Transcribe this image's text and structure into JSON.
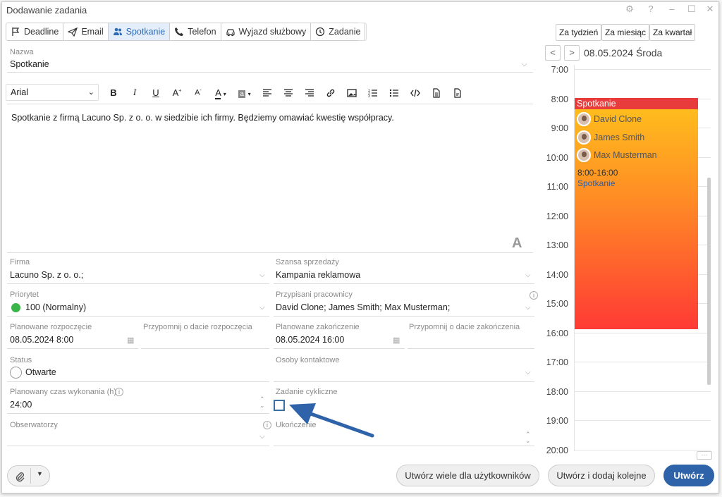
{
  "window": {
    "title": "Dodawanie zadania"
  },
  "tabs": [
    {
      "label": "Deadline",
      "icon": "flag-icon"
    },
    {
      "label": "Email",
      "icon": "paper-plane-icon"
    },
    {
      "label": "Spotkanie",
      "icon": "people-icon",
      "active": true
    },
    {
      "label": "Telefon",
      "icon": "phone-icon"
    },
    {
      "label": "Wyjazd służbowy",
      "icon": "car-icon"
    },
    {
      "label": "Zadanie",
      "icon": "clock-icon"
    }
  ],
  "name_field": {
    "label": "Nazwa",
    "value": "Spotkanie"
  },
  "editor": {
    "font": "Arial",
    "text": "Spotkanie z firmą Lacuno Sp. z o. o. w siedzibie ich firmy. Będziemy omawiać kwestię współpracy.",
    "a_letter": "A"
  },
  "fields": {
    "firma": {
      "label": "Firma",
      "value": "Lacuno Sp. z o. o.;"
    },
    "szansa": {
      "label": "Szansa sprzedaży",
      "value": "Kampania reklamowa"
    },
    "priorytet": {
      "label": "Priorytet",
      "value": "100 (Normalny)"
    },
    "pracownicy": {
      "label": "Przypisani pracownicy",
      "value": "David Clone; James Smith; Max Musterman;"
    },
    "start": {
      "label": "Planowane rozpoczęcie",
      "value": "08.05.2024 8:00"
    },
    "remind_start": {
      "label": "Przypomnij o dacie rozpoczęcia",
      "value": ""
    },
    "end": {
      "label": "Planowane zakończenie",
      "value": "08.05.2024 16:00"
    },
    "remind_end": {
      "label": "Przypomnij o dacie zakończenia",
      "value": ""
    },
    "status": {
      "label": "Status",
      "value": "Otwarte"
    },
    "kontakty": {
      "label": "Osoby kontaktowe",
      "value": ""
    },
    "czas": {
      "label": "Planowany czas wykonania (h)",
      "value": "24:00"
    },
    "cykliczne": {
      "label": "Zadanie cykliczne",
      "checked": false
    },
    "obserwatorzy": {
      "label": "Obserwatorzy",
      "value": ""
    },
    "ukonczenie": {
      "label": "Ukończenie",
      "value": ""
    }
  },
  "calendar": {
    "range_buttons": [
      "Za tydzień",
      "Za miesiąc",
      "Za kwartał"
    ],
    "date": "08.05.2024 Środa",
    "hours": [
      "7:00",
      "8:00",
      "9:00",
      "10:00",
      "11:00",
      "12:00",
      "13:00",
      "14:00",
      "15:00",
      "16:00",
      "17:00",
      "18:00",
      "19:00",
      "20:00"
    ],
    "event": {
      "title": "Spotkanie",
      "participants": [
        "David Clone",
        "James Smith",
        "Max Musterman"
      ],
      "time": "8:00-16:00",
      "type": "Spotkanie"
    }
  },
  "buttons": {
    "create_many": "Utwórz wiele dla użytkowników",
    "create_next": "Utwórz i dodaj kolejne",
    "create": "Utwórz"
  },
  "colors": {
    "accent": "#2f63a9",
    "event_head": "#e83c3c",
    "priority": "#3bb54a"
  }
}
